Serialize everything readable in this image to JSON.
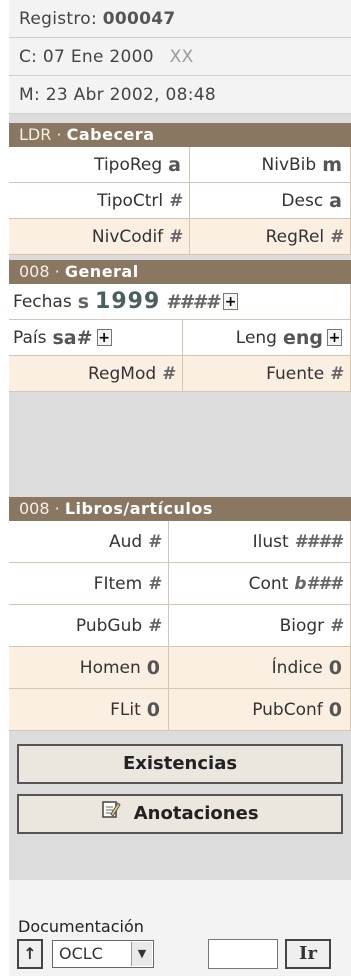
{
  "header": {
    "registro_label": "Registro:",
    "registro_value": "000047",
    "created_label": "C:",
    "created_value": "07 Ene 2000",
    "created_extra": "XX",
    "modified_label": "M:",
    "modified_value": "23 Abr 2002, 08:48"
  },
  "ldr": {
    "prefix": "LDR ·",
    "title": "Cabecera",
    "rows": [
      [
        {
          "label": "TipoReg",
          "value": "a"
        },
        {
          "label": "NivBib",
          "value": "m"
        }
      ],
      [
        {
          "label": "TipoCtrl",
          "value": "#"
        },
        {
          "label": "Desc",
          "value": "a"
        }
      ],
      [
        {
          "label": "NivCodif",
          "value": "#"
        },
        {
          "label": "RegRel",
          "value": "#"
        }
      ]
    ]
  },
  "general": {
    "prefix": "008 ·",
    "title": "General",
    "fechas_label": "Fechas",
    "fechas_type": "s",
    "fechas_1": "1999",
    "fechas_2": "####",
    "pais_label": "País",
    "pais_value": "sa#",
    "leng_label": "Leng",
    "leng_value": "eng",
    "regmod_label": "RegMod",
    "regmod_value": "#",
    "fuente_label": "Fuente",
    "fuente_value": "#"
  },
  "libros": {
    "prefix": "008 ·",
    "title": "Libros/artículos",
    "rows": [
      [
        {
          "label": "Aud",
          "value": "#"
        },
        {
          "label": "Ilust",
          "value": "####"
        }
      ],
      [
        {
          "label": "FItem",
          "value": "#"
        },
        {
          "label": "Cont",
          "value": "b###"
        }
      ],
      [
        {
          "label": "PubGub",
          "value": "#"
        },
        {
          "label": "Biogr",
          "value": "#"
        }
      ],
      [
        {
          "label": "Homen",
          "value": "0"
        },
        {
          "label": "Índice",
          "value": "0"
        }
      ],
      [
        {
          "label": "FLit",
          "value": "0"
        },
        {
          "label": "PubConf",
          "value": "0"
        }
      ]
    ]
  },
  "buttons": {
    "existencias": "Existencias",
    "anotaciones": "Anotaciones"
  },
  "doc": {
    "label": "Documentación",
    "select_value": "OCLC",
    "go_label": "Ir"
  }
}
